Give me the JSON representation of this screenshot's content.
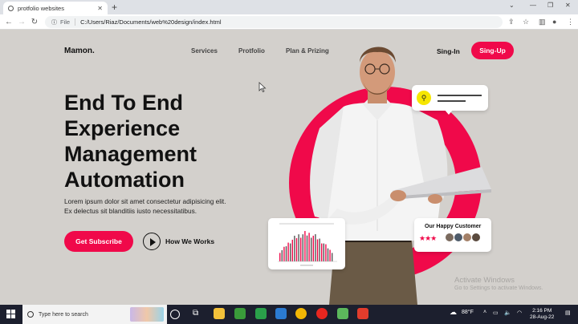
{
  "browser": {
    "tab_title": "protfolio websites",
    "url_scheme_label": "File",
    "url": "C:/Users/Riaz/Documents/web%20design/index.html"
  },
  "site": {
    "logo": "Mamon.",
    "nav": [
      "Services",
      "Protfolio",
      "Plan & Prizing"
    ],
    "signin": "Sing-In",
    "signup": "Sing-Up",
    "hero_lines": [
      "End To End",
      "Experience",
      "Management",
      "Automation"
    ],
    "description_lines": [
      "Lorem ipsum dolor sit amet consectetur adipisicing elit.",
      "Ex delectus sit blanditiis iusto necessitatibus."
    ],
    "subscribe": "Get Subscribe",
    "how_works": "How We Works",
    "customer_card_title": "Our Happy Customer",
    "rating_stars": 3,
    "accent_color": "#f0094a"
  },
  "watermark": {
    "line1": "Activate Windows",
    "line2": "Go to Settings to activate Windows."
  },
  "taskbar": {
    "search_placeholder": "Type here to search",
    "weather": "88°F",
    "time": "2:16 PM",
    "date": "28-Aug-22"
  },
  "icons": [
    "windows-icon",
    "search-icon",
    "task-view-icon",
    "folder-icon",
    "camtasia-icon",
    "vscode-icon",
    "chrome-icon",
    "opera-icon",
    "notepad-icon",
    "recording-icon",
    "weather-icon",
    "chevron-up-icon",
    "network-icon",
    "volume-icon",
    "notification-icon"
  ]
}
